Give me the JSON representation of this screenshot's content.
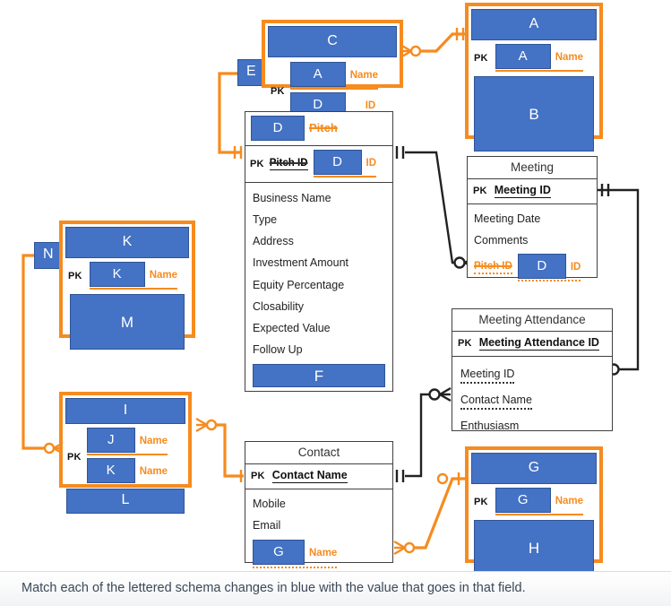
{
  "caption": "Match each of the lettered schema changes in blue with the value that goes in that field.",
  "colors": {
    "accent_blue": "#4472C4",
    "accent_blue_border": "#2F5496",
    "highlight_orange": "#F68B1F",
    "line_black": "#222222",
    "entity_border": "#404040"
  },
  "entities": {
    "c_entity": {
      "header_chip": "C",
      "pk_label": "PK",
      "attr1_chip": "A",
      "attr1_label": "Name",
      "attr2_chip": "D",
      "attr2_label": "ID"
    },
    "e_tag": {
      "label": "E"
    },
    "a_entity": {
      "header_chip": "A",
      "pk_label": "PK",
      "pk_chip": "A",
      "pk_label_text": "Name",
      "body_chip": "B"
    },
    "pitch": {
      "header_chip": "D",
      "header_struck": "Pitch",
      "pk_label": "PK",
      "pk_struck": "Pitch ID",
      "pk_chip": "D",
      "pk_orange": "ID",
      "fields": [
        "Business Name",
        "Type",
        "Address",
        "Investment Amount",
        "Equity Percentage",
        "Closability",
        "Expected Value",
        "Follow Up"
      ],
      "footer_chip": "F"
    },
    "meeting": {
      "title": "Meeting",
      "pk_label": "PK",
      "pk_name": "Meeting ID",
      "fields": [
        "Meeting Date",
        "Comments"
      ],
      "fk_struck": "Pitch ID",
      "fk_chip": "D",
      "fk_orange": "ID"
    },
    "meeting_attendance": {
      "title": "Meeting Attendance",
      "pk_label": "PK",
      "pk_name": "Meeting Attendance  ID",
      "fields": [
        "Meeting ID",
        "Contact Name",
        "Enthusiasm"
      ]
    },
    "contact": {
      "title": "Contact",
      "pk_label": "PK",
      "pk_name": "Contact Name",
      "fields": [
        "Mobile",
        "Email"
      ],
      "fk_chip": "G",
      "fk_label": "Name"
    },
    "g_entity": {
      "header_chip": "G",
      "pk_label": "PK",
      "pk_chip": "G",
      "pk_orange": "Name",
      "body_chip": "H"
    },
    "k_entity": {
      "header_chip": "K",
      "pk_label": "PK",
      "pk_chip": "K",
      "pk_orange": "Name",
      "body_chip": "M"
    },
    "n_tag": {
      "label": "N"
    },
    "i_entity": {
      "header_chip": "I",
      "pk_label": "PK",
      "attr1_chip": "J",
      "attr1_label": "Name",
      "attr2_chip": "K",
      "attr2_label": "Name",
      "footer_chip": "L"
    }
  }
}
